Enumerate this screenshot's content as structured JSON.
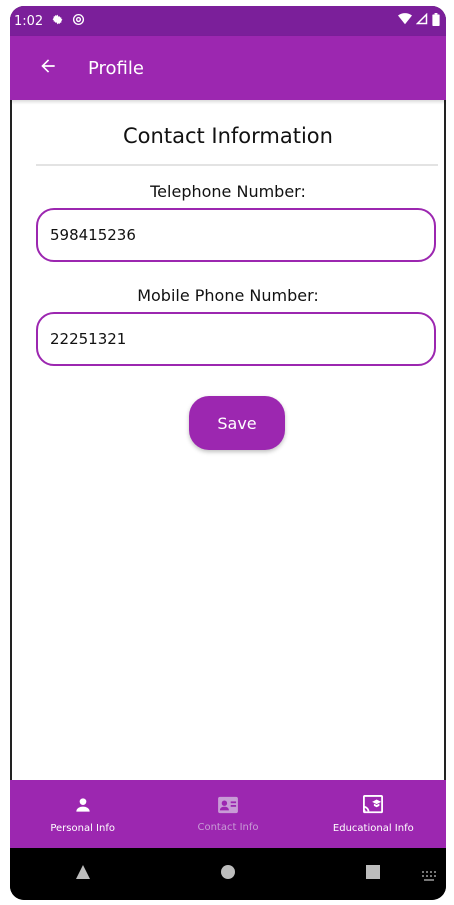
{
  "status_bar": {
    "time": "1:02",
    "left_icons": [
      "gear-icon",
      "at-icon"
    ],
    "right_icons": [
      "wifi-icon",
      "signal-icon",
      "battery-icon"
    ]
  },
  "app_bar": {
    "title": "Profile",
    "back_icon": "arrow-left-icon"
  },
  "contact": {
    "section_title": "Contact Information",
    "telephone_label": "Telephone Number:",
    "telephone_value": "598415236",
    "mobile_label": "Mobile Phone Number:",
    "mobile_value": "22251321",
    "save_label": "Save"
  },
  "bottom_nav": {
    "items": [
      {
        "label": "Personal Info",
        "icon": "person-icon",
        "active": false
      },
      {
        "label": "Contact Info",
        "icon": "contact-card-icon",
        "active": true
      },
      {
        "label": "Educational Info",
        "icon": "cast-for-education-icon",
        "active": false
      }
    ]
  },
  "colors": {
    "status_bar": "#7b1f9a",
    "primary": "#9c27b0",
    "active_nav_label": "#c89bd6",
    "system_nav": "#000000"
  }
}
